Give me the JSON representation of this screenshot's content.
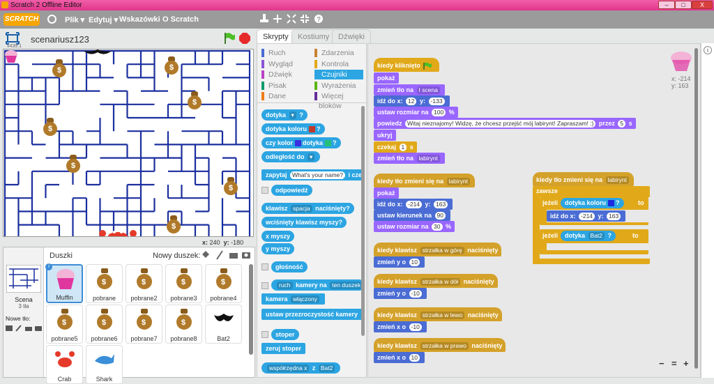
{
  "window": {
    "title": "Scratch 2 Offline Editor",
    "minimize": "–",
    "maximize": "□",
    "close": "X"
  },
  "menu": {
    "logo": "SCRATCH",
    "items": [
      "Plik ▾",
      "Edytuj ▾",
      "Wskazówki",
      "O Scratch"
    ]
  },
  "stage": {
    "project_name": "scenariusz123",
    "version": "v439.1",
    "x_label": "x:",
    "x": "240",
    "y_label": "y:",
    "y": "-180",
    "bag_glyph": "$"
  },
  "sprites": {
    "header": "Duszki",
    "new_sprite_label": "Nowy duszek:",
    "scene": {
      "label": "Scena",
      "sub": "3 tła"
    },
    "new_backdrop_label": "Nowe tło:",
    "list": [
      "Muffin",
      "pobrane",
      "pobrane2",
      "pobrane3",
      "pobrane4",
      "pobrane5",
      "pobrane6",
      "pobrane7",
      "pobrane8",
      "Bat2",
      "Crab",
      "Shark"
    ]
  },
  "tabs": [
    "Skrypty",
    "Kostiumy",
    "Dźwięki"
  ],
  "categories": [
    {
      "label": "Ruch",
      "color": "#4a6cd4"
    },
    {
      "label": "Zdarzenia",
      "color": "#c88330"
    },
    {
      "label": "Wygląd",
      "color": "#8a55d7"
    },
    {
      "label": "Kontrola",
      "color": "#e1a91a"
    },
    {
      "label": "Dźwięk",
      "color": "#bb42c3"
    },
    {
      "label": "Czujniki",
      "color": "#2ca5e2"
    },
    {
      "label": "Pisak",
      "color": "#0e9a6c"
    },
    {
      "label": "Wyrażenia",
      "color": "#5cb712"
    },
    {
      "label": "Dane",
      "color": "#ee7d16"
    },
    {
      "label": "Więcej bloków",
      "color": "#632d99"
    }
  ],
  "palette": {
    "dotyka": "dotyka",
    "dotyka_q": "?",
    "dotyka_koloru": "dotyka koloru",
    "q": "?",
    "czy_kolor": "czy kolor",
    "czy_kolor_dotyka": "dotyka",
    "odleglosc": "odległość do",
    "zapytaj": "zapytaj",
    "zapytaj_field": "What's your name?",
    "i_czekaj": "i czek",
    "odpowiedz": "odpowiedź",
    "klawisz": "klawisz",
    "spacja": "spacja",
    "nacisniety": "naciśnięty?",
    "wcisniety": "wciśnięty klawisz myszy?",
    "x_myszy": "x myszy",
    "y_myszy": "y myszy",
    "glosnosc": "głośność",
    "ruch": "ruch",
    "kamery_na": "kamery na",
    "ten_duszek": "ten duszek",
    "kamera": "kamera",
    "wlaczony": "włączony",
    "przezroczystosc": "ustaw przezroczystość kamery",
    "stoper": "stoper",
    "zeruj_stoper": "zeruj stoper",
    "wspolrzedna": "współrzędna x",
    "wspolrzedna_z": "z",
    "bat2": "Bat2"
  },
  "scripts": {
    "s1": {
      "hat": "kiedy kliknięto",
      "pokaz": "pokaż",
      "zmien_tlo_1": "zmień tło na",
      "zmien_tlo_1_v": "I scena",
      "idz": "idź do x:",
      "idz_x": "12",
      "idz_y_label": "y:",
      "idz_y": "-133",
      "rozmiar": "ustaw rozmiar na",
      "rozmiar_v": "100",
      "rozmiar_pct": "%",
      "powiedz": "powiedz",
      "powiedz_txt": "Witaj nieznajomy! Widzę, że chcesz przejść mój labirynt! Zapraszam! :)",
      "przez": "przez",
      "przez_v": "5",
      "s": "s",
      "ukryj": "ukryj",
      "czekaj": "czekaj",
      "czekaj_v": "1",
      "czekaj_s": "s",
      "zmien_tlo_2": "zmień tło na",
      "zmien_tlo_2_v": "labirynt"
    },
    "s2": {
      "hat": "kiedy tło zmieni się na",
      "hat_v": "labirynt",
      "pokaz": "pokaż",
      "idz": "idź do x:",
      "idz_x": "-214",
      "idz_y_label": "y:",
      "idz_y": "163",
      "kierunek": "ustaw kierunek na",
      "kierunek_v": "90",
      "rozmiar": "ustaw rozmiar na",
      "rozmiar_v": "30",
      "rozmiar_pct": "%"
    },
    "s3": {
      "hat": "kiedy klawisz",
      "key": "strzałka w górę",
      "hat2": "naciśnięty",
      "cmd": "zmień y o",
      "v": "10"
    },
    "s4": {
      "hat": "kiedy klawisz",
      "key": "strzałka w dół",
      "hat2": "naciśnięty",
      "cmd": "zmień y o",
      "v": "-10"
    },
    "s5": {
      "hat": "kiedy klawisz",
      "key": "strzałka w lewo",
      "hat2": "naciśnięty",
      "cmd": "zmień x o",
      "v": "-10"
    },
    "s6": {
      "hat": "kiedy klawisz",
      "key": "strzałka w prawo",
      "hat2": "naciśnięty",
      "cmd": "zmień x o",
      "v": "10"
    },
    "s7": {
      "hat": "kiedy tło zmieni się na",
      "hat_v": "labirynt",
      "zawsze": "zawsze",
      "jezeli1": "jeżeli",
      "dotyka_koloru": "dotyka koloru",
      "q1": "?",
      "to1": "to",
      "idz": "idź do x:",
      "idz_x": "-214",
      "idz_y_label": "y:",
      "idz_y": "163",
      "jezeli2": "jeżeli",
      "dotyka": "dotyka",
      "dotyka_v": "Bat2",
      "q2": "?",
      "to2": "to"
    }
  },
  "sprite_info": {
    "x_label": "x:",
    "x": "-214",
    "y_label": "y:",
    "y": "163"
  },
  "zoom": {
    "out": "−",
    "reset": "=",
    "in": "+"
  }
}
